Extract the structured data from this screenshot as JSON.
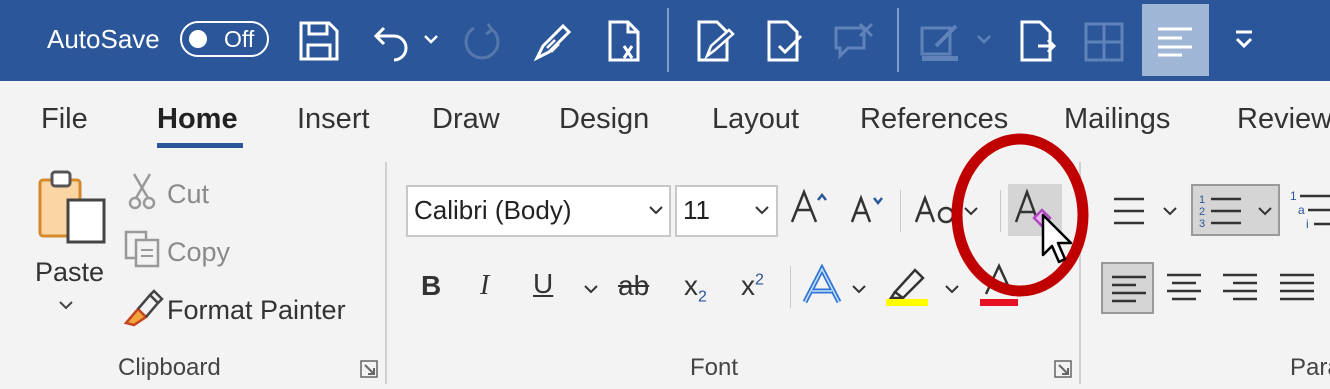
{
  "qat": {
    "autosave_label": "AutoSave",
    "autosave_state": "Off"
  },
  "tabs": [
    "File",
    "Home",
    "Insert",
    "Draw",
    "Design",
    "Layout",
    "References",
    "Mailings",
    "Review"
  ],
  "active_tab": "Home",
  "clipboard": {
    "paste_label": "Paste",
    "cut_label": "Cut",
    "copy_label": "Copy",
    "format_painter_label": "Format Painter",
    "group_label": "Clipboard"
  },
  "font": {
    "font_name": "Calibri (Body)",
    "font_size": "11",
    "group_label": "Font"
  },
  "paragraph": {
    "group_label": "Para"
  },
  "colors": {
    "title_bar": "#2b579a",
    "highlight": "#ffff00",
    "font_color": "#e81123",
    "annotation_circle": "#c00000",
    "eraser_accent": "#b146c2"
  }
}
